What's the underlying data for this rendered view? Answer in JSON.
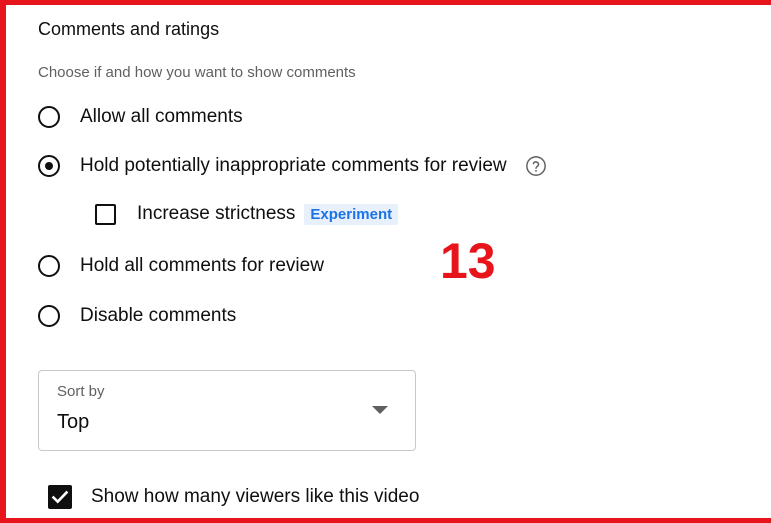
{
  "section": {
    "title": "Comments and ratings",
    "subtitle": "Choose if and how you want to show comments"
  },
  "comment_options": [
    {
      "label": "Allow all comments",
      "selected": false
    },
    {
      "label": "Hold potentially inappropriate comments for review",
      "selected": true
    },
    {
      "label": "Hold all comments for review",
      "selected": false
    },
    {
      "label": "Disable comments",
      "selected": false
    }
  ],
  "help_icon": "question-circle-icon",
  "strictness": {
    "label": "Increase strictness",
    "checked": false,
    "badge": "Experiment"
  },
  "annotation": {
    "number": "13",
    "color": "#e8141c"
  },
  "sort": {
    "label": "Sort by",
    "value": "Top",
    "icon": "dropdown-triangle-icon"
  },
  "show_likes": {
    "label": "Show how many viewers like this video",
    "checked": true
  },
  "colors": {
    "accent": "#1a73e8",
    "frame": "#e8141c",
    "badge_bg": "#e8f0fb"
  }
}
